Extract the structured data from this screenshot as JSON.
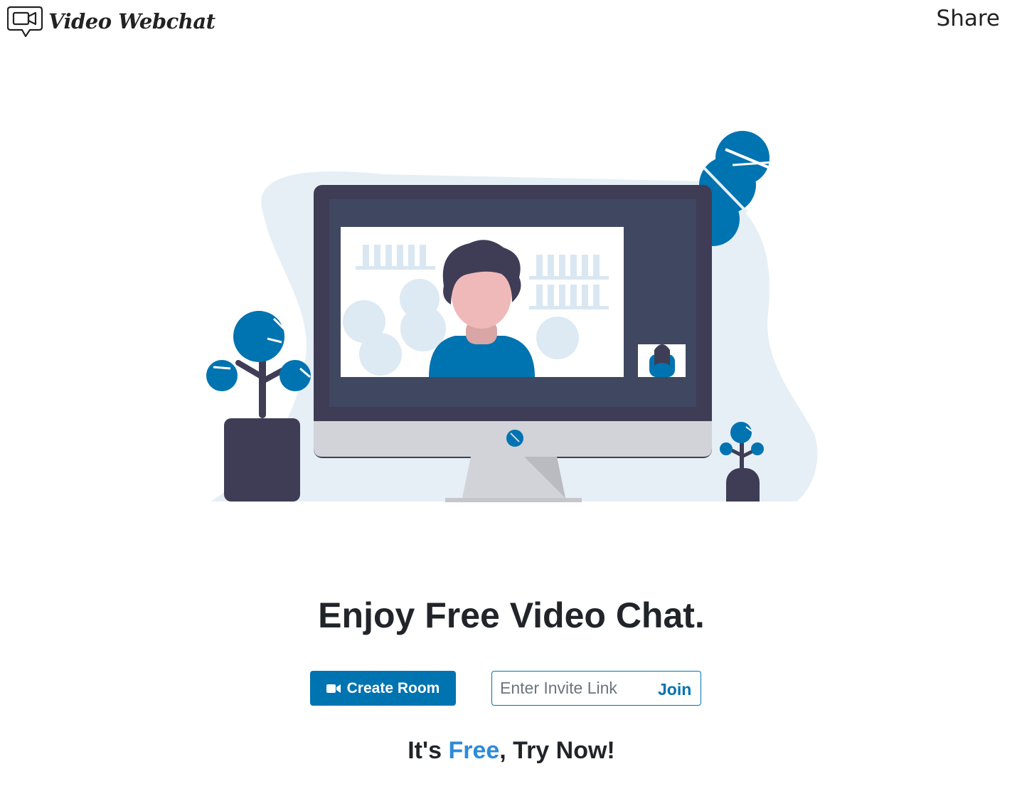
{
  "header": {
    "brand_name": "Video Webchat",
    "share_label": "Share"
  },
  "hero": {
    "illustration": "video-conference-illustration",
    "colors": {
      "accent": "#0073b1",
      "monitor_dark": "#3f3d56",
      "backdrop": "#e6eff6"
    }
  },
  "main": {
    "headline": "Enjoy Free Video Chat.",
    "create_room_label": "Create Room",
    "create_room_icon": "video-camera-icon",
    "invite_placeholder": "Enter Invite Link",
    "join_label": "Join",
    "tagline_prefix": "It's ",
    "tagline_accent": "Free",
    "tagline_suffix": ", Try Now!"
  },
  "colors": {
    "primary": "#0073b1",
    "tagline_accent": "#2e8ad8",
    "text": "#212529"
  }
}
